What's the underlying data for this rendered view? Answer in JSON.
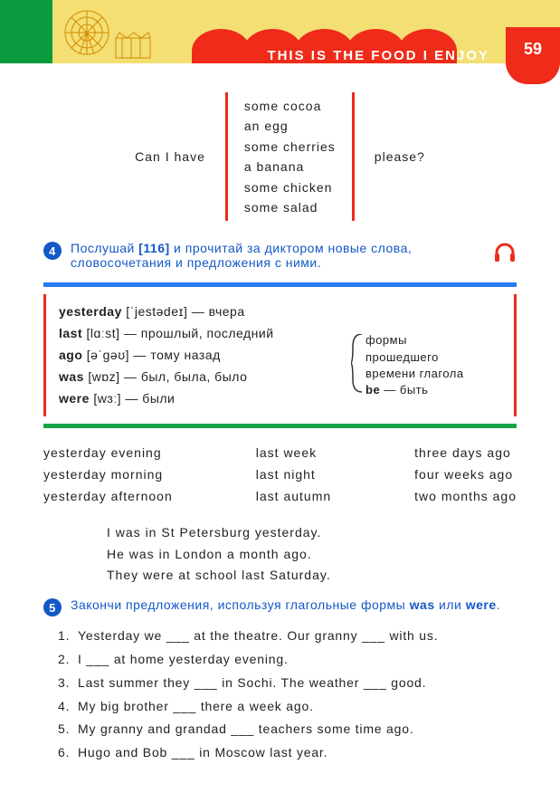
{
  "header": {
    "title": "THIS IS THE FOOD I ENJOY",
    "page_number": "59"
  },
  "can_i_have": {
    "left": "Can I have",
    "items": [
      "some cocoa",
      "an egg",
      "some cherries",
      "a banana",
      "some chicken",
      "some salad"
    ],
    "right": "please?"
  },
  "task4": {
    "number": "4",
    "text_1": "Послушай ",
    "track": "[116]",
    "text_2": " и прочитай за диктором новые слова, словосочетания и предложения с ними."
  },
  "vocab": {
    "items": [
      {
        "word": "yesterday",
        "ipa": "[ˈjestədeɪ]",
        "dash": " — ",
        "trans": "вчера"
      },
      {
        "word": "last",
        "ipa": "[lɑːst]",
        "dash": " — ",
        "trans": "прошлый, последний"
      },
      {
        "word": "ago",
        "ipa": "[əˈɡəʊ]",
        "dash": " — ",
        "trans": "тому назад"
      },
      {
        "word": "was",
        "ipa": "[wɒz]",
        "dash": " — ",
        "trans": "был, была, было"
      },
      {
        "word": "were",
        "ipa": "[wɜː]",
        "dash": " — ",
        "trans": "были"
      }
    ],
    "note_lines": [
      "формы",
      "прошедшего",
      "времени глагола"
    ],
    "be_word": "be",
    "be_trans": " — быть"
  },
  "time_expr": {
    "col1": [
      "yesterday evening",
      "yesterday morning",
      "yesterday afternoon"
    ],
    "col2": [
      "last week",
      "last night",
      "last autumn"
    ],
    "col3": [
      "three days ago",
      "four weeks ago",
      "two months ago"
    ]
  },
  "example_sentences": [
    "I was in St Petersburg yesterday.",
    "He was in London a month ago.",
    "They were at school last Saturday."
  ],
  "task5": {
    "number": "5",
    "text_1": "Закончи предложения, используя глагольные формы ",
    "bold1": "was",
    "or": " или ",
    "bold2": "were",
    "dot": ".",
    "items": [
      "Yesterday we ___ at the theatre. Our granny ___ with us.",
      "I ___ at home yesterday evening.",
      "Last summer they ___ in Sochi. The weather ___ good.",
      "My big brother ___ there a week ago.",
      "My granny and grandad ___ teachers some time ago.",
      "Hugo and Bob ___ in Moscow last year."
    ]
  }
}
